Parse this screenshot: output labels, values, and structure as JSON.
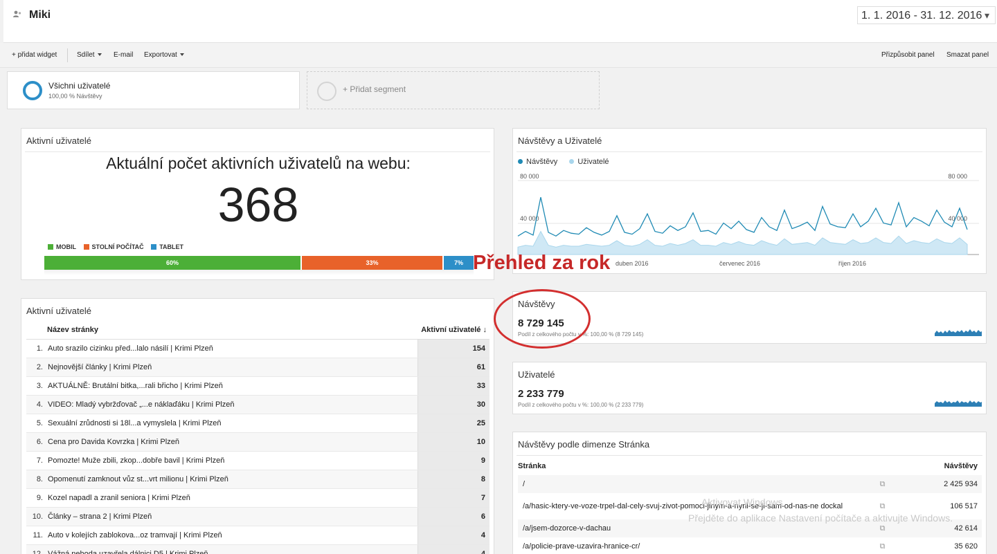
{
  "header": {
    "title": "Miki",
    "date_range": "1. 1. 2016 - 31. 12. 2016"
  },
  "toolbar": {
    "add_widget": "+ přidat widget",
    "share": "Sdílet",
    "email": "E-mail",
    "export": "Exportovat",
    "customize": "Přizpůsobit panel",
    "delete": "Smazat panel"
  },
  "segments": {
    "all_users": {
      "name": "Všichni uživatelé",
      "share": "100,00 % Návštěvy"
    },
    "add_segment": "+ Přidat segment"
  },
  "active_users": {
    "title": "Aktivní uživatelé",
    "headline": "Aktuální počet aktivních uživatelů na webu:",
    "count": "368",
    "devices": [
      {
        "label": "MOBIL",
        "percent": 60,
        "percent_label": "60%",
        "color": "#4caf37"
      },
      {
        "label": "STOLNÍ POČÍTAČ",
        "percent": 33,
        "percent_label": "33%",
        "color": "#e8622a"
      },
      {
        "label": "TABLET",
        "percent": 7,
        "percent_label": "7%",
        "color": "#2d8fc8"
      }
    ]
  },
  "active_pages": {
    "title": "Aktivní uživatelé",
    "col_page": "Název stránky",
    "col_users": "Aktivní uživatelé ↓",
    "rows": [
      {
        "idx": "1.",
        "page": "Auto srazilo cizinku před...lalo násilí | Krimi Plzeň",
        "users": "154"
      },
      {
        "idx": "2.",
        "page": "Nejnovější články | Krimi Plzeň",
        "users": "61"
      },
      {
        "idx": "3.",
        "page": "AKTUÁLNĚ: Brutální bitka,...rali břicho | Krimi Plzeň",
        "users": "33"
      },
      {
        "idx": "4.",
        "page": "VIDEO: Mladý vybržďovač „...e náklaďáku | Krimi Plzeň",
        "users": "30"
      },
      {
        "idx": "5.",
        "page": "Sexuální zrůdnosti si 18l...a vymyslela | Krimi Plzeň",
        "users": "25"
      },
      {
        "idx": "6.",
        "page": "Cena pro Davida Kovrzka | Krimi Plzeň",
        "users": "10"
      },
      {
        "idx": "7.",
        "page": "Pomozte! Muže zbili, zkop...dobře bavil | Krimi Plzeň",
        "users": "9"
      },
      {
        "idx": "8.",
        "page": "Opomenutí zamknout vůz st...vrt milionu | Krimi Plzeň",
        "users": "8"
      },
      {
        "idx": "9.",
        "page": "Kozel napadl a zranil seniora | Krimi Plzeň",
        "users": "7"
      },
      {
        "idx": "10.",
        "page": "Články – strana 2 | Krimi Plzeň",
        "users": "6"
      },
      {
        "idx": "11.",
        "page": "Auto v kolejích zablokova...oz tramvají | Krimi Plzeň",
        "users": "4"
      },
      {
        "idx": "12.",
        "page": "Vážná nehoda uzavřela dálnici D5 | Krimi Plzeň",
        "users": "4"
      }
    ]
  },
  "visits_chart": {
    "title": "Návštěvy a Uživatelé",
    "legend": [
      {
        "name": "Návštěvy",
        "color": "#1f8ab4"
      },
      {
        "name": "Uživatelé",
        "color": "#a9d6ec"
      }
    ],
    "y_left_top": "80 000",
    "y_left_mid": "40 000",
    "y_right_top": "80 000",
    "y_right_mid": "40 000",
    "x_labels": [
      "duben 2016",
      "červenec 2016",
      "říjen 2016"
    ]
  },
  "chart_data": {
    "type": "line",
    "title": "Návštěvy a Uživatelé",
    "xlabel": "",
    "ylabel": "",
    "ylim": [
      0,
      80000
    ],
    "x_range": [
      "2016-01-01",
      "2016-12-31"
    ],
    "x_tick_labels": [
      "duben 2016",
      "červenec 2016",
      "říjen 2016"
    ],
    "series": [
      {
        "name": "Návštěvy",
        "values": [
          20000,
          25000,
          21000,
          62000,
          24000,
          20000,
          26000,
          23000,
          22000,
          29000,
          24000,
          21000,
          25000,
          42000,
          24000,
          22000,
          28000,
          44000,
          25000,
          23000,
          31000,
          26000,
          30000,
          45000,
          25000,
          26000,
          22000,
          34000,
          28000,
          36000,
          27000,
          24000,
          40000,
          30000,
          26000,
          48000,
          28000,
          31000,
          35000,
          26000,
          52000,
          33000,
          30000,
          29000,
          44000,
          30000,
          36000,
          50000,
          34000,
          32000,
          56000,
          30000,
          40000,
          36000,
          31000,
          48000,
          35000,
          30000,
          50000,
          27000
        ]
      },
      {
        "name": "Uživatelé",
        "values": [
          8000,
          10000,
          9000,
          25000,
          10000,
          8000,
          10000,
          9000,
          9000,
          11000,
          10000,
          9000,
          10000,
          15000,
          10000,
          9000,
          11000,
          16000,
          10000,
          9000,
          12000,
          10000,
          12000,
          16000,
          10000,
          10000,
          9000,
          13000,
          11000,
          14000,
          11000,
          10000,
          15000,
          12000,
          10000,
          17000,
          11000,
          12000,
          13000,
          10000,
          18000,
          13000,
          12000,
          11000,
          16000,
          12000,
          13000,
          18000,
          13000,
          12000,
          20000,
          12000,
          15000,
          13000,
          12000,
          17000,
          13000,
          12000,
          18000,
          11000
        ]
      }
    ],
    "grid": true,
    "legend_position": "top-left"
  },
  "visits_card": {
    "title": "Návštěvy",
    "value": "8 729 145",
    "note": "Podíl z celkového počtu v %: 100,00 % (8 729 145)"
  },
  "users_card": {
    "title": "Uživatelé",
    "value": "2 233 779",
    "note": "Podíl z celkového počtu v %: 100,00 % (2 233 779)"
  },
  "page_dimension": {
    "title": "Návštěvy podle dimenze Stránka",
    "col_page": "Stránka",
    "col_visits": "Návštěvy",
    "rows": [
      {
        "path": "/",
        "visits": "2 425 934"
      },
      {
        "path": "/a/hasic-ktery-ve-voze-trpel-dal-cely-svuj-zivot-pomoci-jinym-a-nyni-se-ji-sam-od-nas-ne dockal",
        "visits": "106 517"
      },
      {
        "path": "/a/jsem-dozorce-v-dachau",
        "visits": "42 614"
      },
      {
        "path": "/a/policie-prave-uzavira-hranice-cr/",
        "visits": "35 620"
      }
    ]
  },
  "annotation": {
    "text": "Přehled za rok",
    "color": "#c62828"
  },
  "watermark": {
    "line1": "Aktivovat Windows",
    "line2": "Přejděte do aplikace Nastavení počítače a aktivujte Windows."
  },
  "icons": {
    "user": "users-icon",
    "link": "external-link-icon",
    "sort": "sort-down-icon"
  }
}
